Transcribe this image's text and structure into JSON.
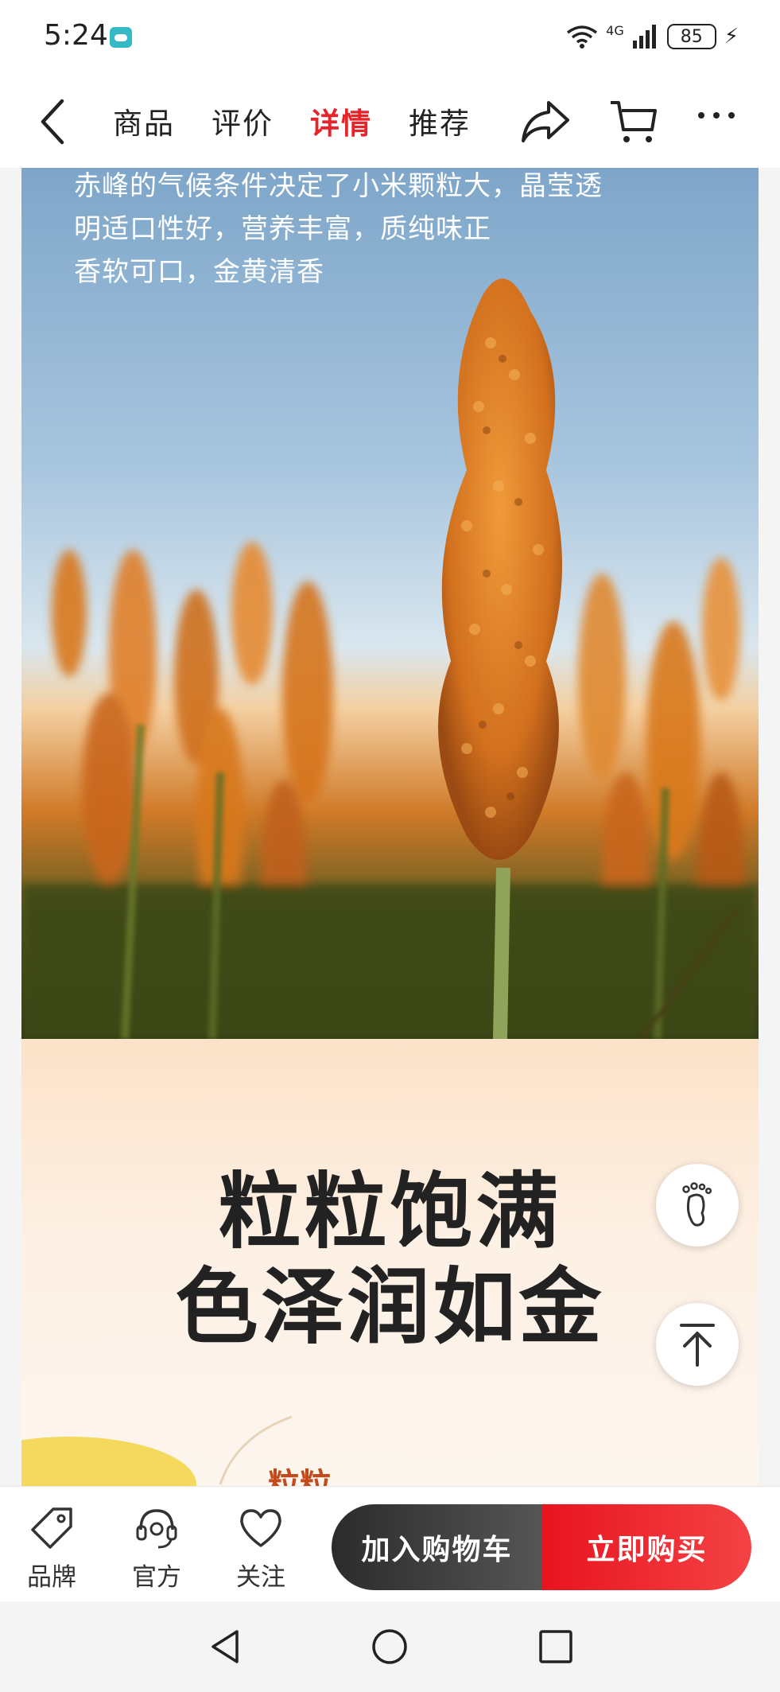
{
  "status_bar": {
    "time": "5:24",
    "network": "4G",
    "battery": "85"
  },
  "nav": {
    "tabs": [
      {
        "label": "商品",
        "active": false
      },
      {
        "label": "评价",
        "active": false
      },
      {
        "label": "详情",
        "active": true
      },
      {
        "label": "推荐",
        "active": false
      }
    ],
    "active_color": "#e8232a"
  },
  "hero": {
    "lines": [
      "赤峰的气候条件决定了小米颗粒大，晶莹透",
      "明适口性好，营养丰富，质纯味正",
      "香软可口，金黄清香"
    ]
  },
  "slogan": {
    "line1": "粒粒饱满",
    "line2": "色泽润如金",
    "partial": "粒粒"
  },
  "float_buttons": {
    "footprint": "footprint-icon",
    "top": "back-to-top-icon"
  },
  "bottom_bar": {
    "actions": [
      {
        "label": "品牌",
        "icon": "tag-icon"
      },
      {
        "label": "官方",
        "icon": "headset-icon"
      },
      {
        "label": "关注",
        "icon": "heart-icon"
      }
    ],
    "add_to_cart": "加入购物车",
    "buy_now": "立即购买"
  }
}
